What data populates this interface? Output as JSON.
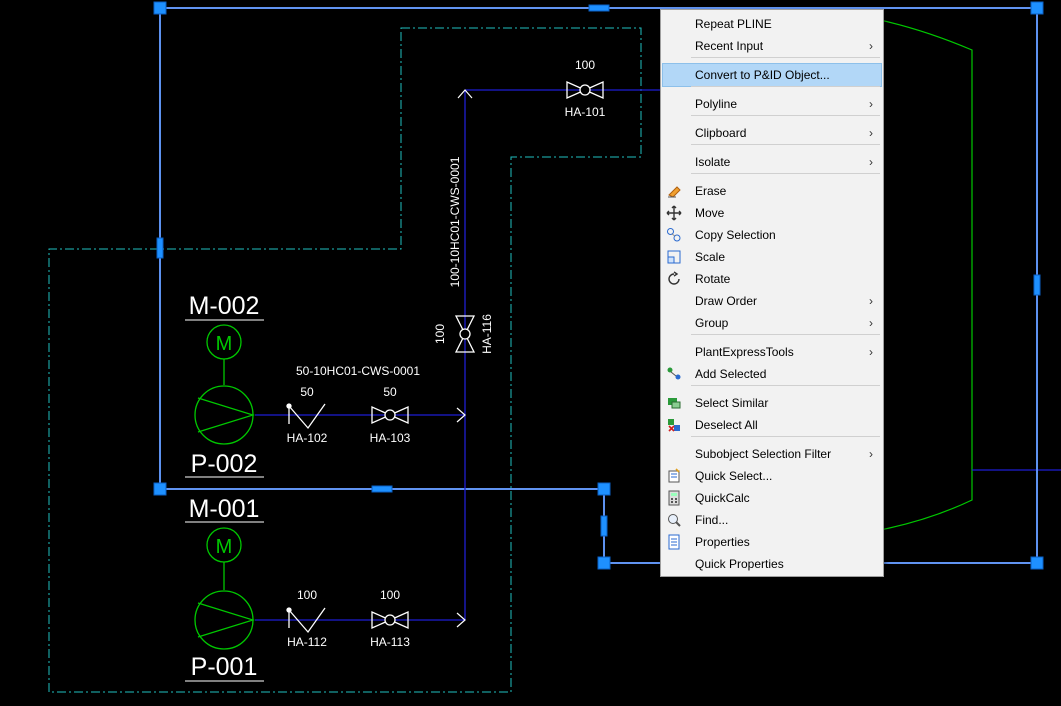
{
  "drawing": {
    "texts": {
      "m002": "M-002",
      "p002": "P-002",
      "m001": "M-001",
      "p001": "P-001",
      "motor_glyph": "M",
      "line_label_50": "50-10HC01-CWS-0001",
      "line_label_100": "100-10HC01-CWS-0001",
      "ha101_size": "100",
      "ha101": "HA-101",
      "ha116_size": "100",
      "ha116": "HA-116",
      "ha102_size": "50",
      "ha102": "HA-102",
      "ha103_size": "50",
      "ha103": "HA-103",
      "ha112_size": "100",
      "ha112": "HA-112",
      "ha113_size": "100",
      "ha113": "HA-113"
    }
  },
  "context_menu": {
    "items": [
      {
        "label": "Repeat PLINE",
        "submenu": false,
        "icon": "",
        "highlighted": false
      },
      {
        "label": "Recent Input",
        "submenu": true,
        "icon": "",
        "highlighted": false
      },
      {
        "label": "Convert to P&ID Object...",
        "submenu": false,
        "icon": "",
        "highlighted": true
      },
      {
        "label": "Polyline",
        "submenu": true,
        "icon": "",
        "highlighted": false
      },
      {
        "label": "Clipboard",
        "submenu": true,
        "icon": "",
        "highlighted": false
      },
      {
        "label": "Isolate",
        "submenu": true,
        "icon": "",
        "highlighted": false
      },
      {
        "label": "Erase",
        "submenu": false,
        "icon": "eraser-icon",
        "highlighted": false
      },
      {
        "label": "Move",
        "submenu": false,
        "icon": "move-icon",
        "highlighted": false
      },
      {
        "label": "Copy Selection",
        "submenu": false,
        "icon": "copy-icon",
        "highlighted": false
      },
      {
        "label": "Scale",
        "submenu": false,
        "icon": "scale-icon",
        "highlighted": false
      },
      {
        "label": "Rotate",
        "submenu": false,
        "icon": "rotate-icon",
        "highlighted": false
      },
      {
        "label": "Draw Order",
        "submenu": true,
        "icon": "",
        "highlighted": false
      },
      {
        "label": "Group",
        "submenu": true,
        "icon": "",
        "highlighted": false
      },
      {
        "label": "PlantExpressTools",
        "submenu": true,
        "icon": "",
        "highlighted": false
      },
      {
        "label": "Add Selected",
        "submenu": false,
        "icon": "add-selected-icon",
        "highlighted": false
      },
      {
        "label": "Select Similar",
        "submenu": false,
        "icon": "select-similar-icon",
        "highlighted": false
      },
      {
        "label": "Deselect All",
        "submenu": false,
        "icon": "deselect-all-icon",
        "highlighted": false
      },
      {
        "label": "Subobject Selection Filter",
        "submenu": true,
        "icon": "",
        "highlighted": false
      },
      {
        "label": "Quick Select...",
        "submenu": false,
        "icon": "quick-select-icon",
        "highlighted": false
      },
      {
        "label": "QuickCalc",
        "submenu": false,
        "icon": "calculator-icon",
        "highlighted": false
      },
      {
        "label": "Find...",
        "submenu": false,
        "icon": "find-icon",
        "highlighted": false
      },
      {
        "label": "Properties",
        "submenu": false,
        "icon": "properties-icon",
        "highlighted": false
      },
      {
        "label": "Quick Properties",
        "submenu": false,
        "icon": "",
        "highlighted": false
      }
    ],
    "submenu_arrow": "›"
  },
  "colors": {
    "background": "#000000",
    "equipment": "#00c800",
    "pipe": "#1e1ed2",
    "boundary": "#20c0c0",
    "selection": "#3a78e8",
    "grip": "#1e90ff",
    "menu_highlight": "#b2d7f7"
  }
}
